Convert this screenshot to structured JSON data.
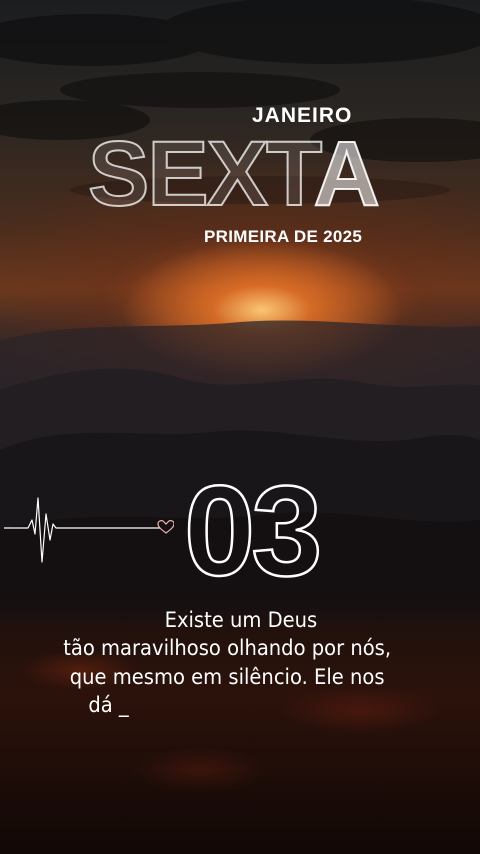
{
  "month": "JANEIRO",
  "weekday": "SEXT",
  "weekday_last_letter": "A",
  "year_line": "PRIMEIRA DE 2025",
  "day": "03",
  "message": {
    "line1": "Existe um Deus",
    "line2": "tão maravilhoso olhando por nós,",
    "line3": "que mesmo em silêncio. Ele nos",
    "line4": "dá _"
  },
  "icons": {
    "pulse": "heartbeat-line-icon",
    "heart": "heart-outline-icon"
  },
  "colors": {
    "text": "#ffffff",
    "sun": "#ffcd78",
    "heart": "#f2b8b0"
  }
}
